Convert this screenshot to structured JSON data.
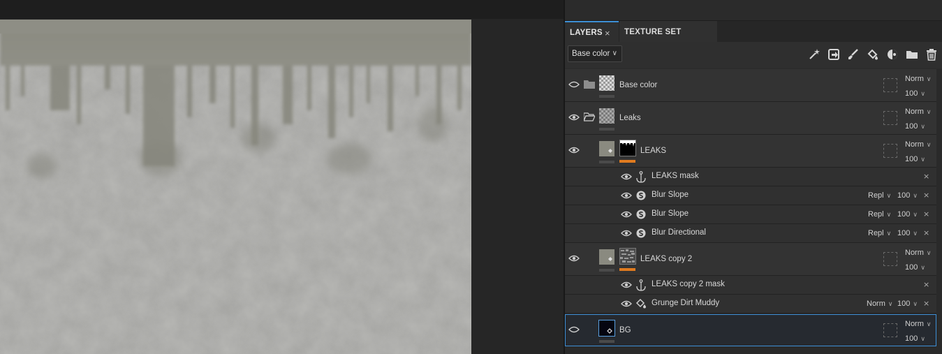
{
  "tabs": [
    {
      "label": "LAYERS",
      "close": "×"
    },
    {
      "label": "TEXTURE SET SETTINGS"
    }
  ],
  "toolbar": {
    "channel": "Base color",
    "icons": [
      "magic-wand-icon",
      "fill-layer-icon",
      "paint-brush-icon",
      "paint-bucket-icon",
      "mask-icon",
      "folder-icon",
      "trash-icon"
    ]
  },
  "layers": [
    {
      "name": "Base color",
      "blend": "Norm",
      "opacity": "100"
    },
    {
      "name": "Leaks",
      "blend": "Norm",
      "opacity": "100"
    },
    {
      "name": "LEAKS",
      "blend": "Norm",
      "opacity": "100",
      "effects": [
        {
          "name": "LEAKS mask",
          "close": "×"
        },
        {
          "name": "Blur Slope",
          "blend": "Repl",
          "opacity": "100",
          "close": "×"
        },
        {
          "name": "Blur Slope",
          "blend": "Repl",
          "opacity": "100",
          "close": "×"
        },
        {
          "name": "Blur Directional",
          "blend": "Repl",
          "opacity": "100",
          "close": "×"
        }
      ]
    },
    {
      "name": "LEAKS copy 2",
      "blend": "Norm",
      "opacity": "100",
      "effects": [
        {
          "name": "LEAKS copy 2 mask",
          "close": "×"
        },
        {
          "name": "Grunge Dirt Muddy",
          "blend": "Norm",
          "opacity": "100",
          "close": "×"
        }
      ]
    },
    {
      "name": "BG",
      "blend": "Norm",
      "opacity": "100"
    }
  ],
  "colors": {
    "accent": "#3d8fd6",
    "mask_indicator": "#e07b1f",
    "panel_bg": "#2b2b2b",
    "texture_base": "#9c9c98"
  }
}
